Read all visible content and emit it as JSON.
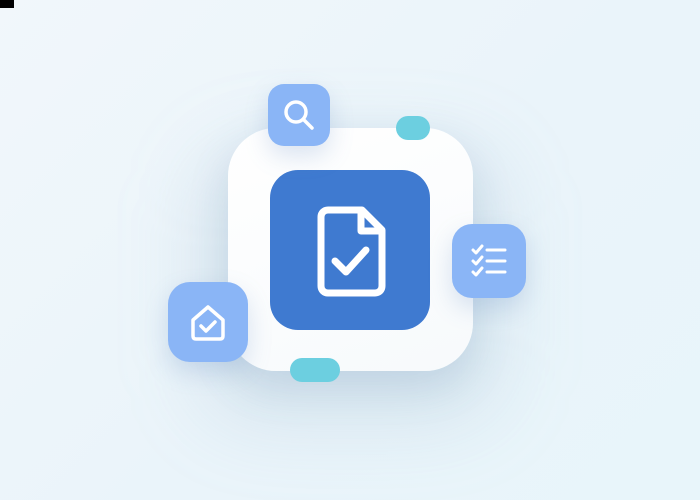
{
  "illustration": {
    "colors": {
      "background": "#eef6fa",
      "card": "#ffffff",
      "primary_tile": "#3f7ad0",
      "secondary_tile": "#8ab5f6",
      "accent_pill": "#6ccfe0",
      "icon_stroke": "#ffffff"
    },
    "icons": {
      "center": "document-check-icon",
      "top": "search-icon",
      "right": "checklist-icon",
      "left": "home-check-icon"
    }
  }
}
